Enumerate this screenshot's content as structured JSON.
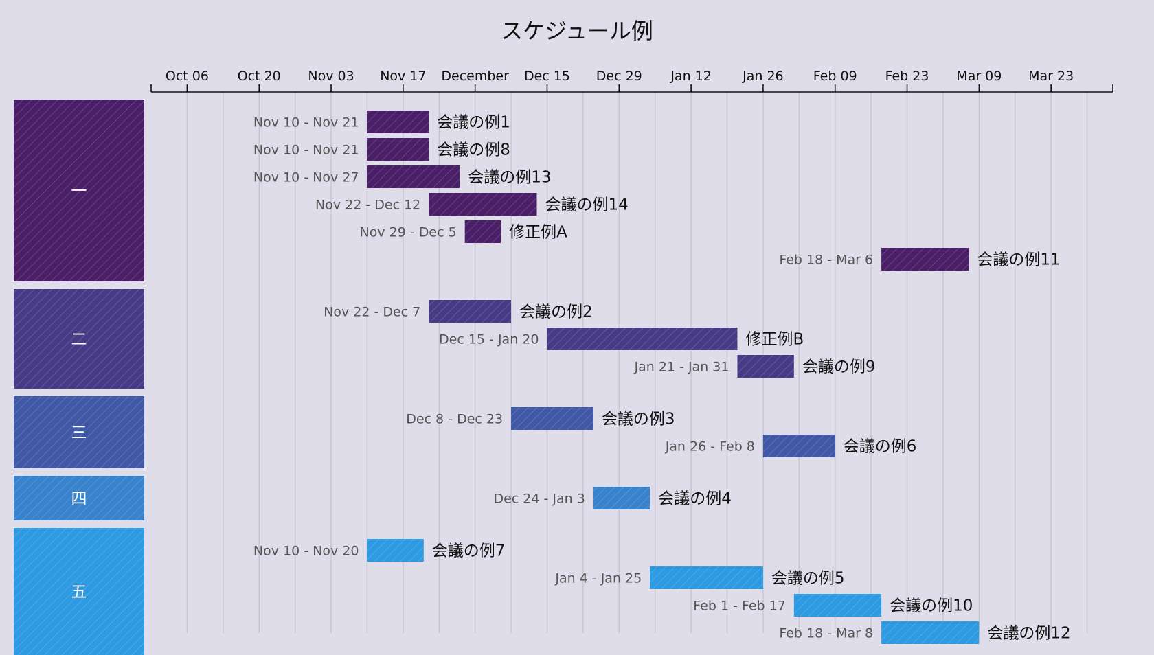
{
  "chart_data": {
    "type": "gantt",
    "title": "スケジュール例",
    "x_start": "2024-09-29",
    "x_end": "2025-04-04",
    "ticks": [
      {
        "date": "2024-10-06",
        "label": "Oct 06"
      },
      {
        "date": "2024-10-20",
        "label": "Oct 20"
      },
      {
        "date": "2024-11-03",
        "label": "Nov 03"
      },
      {
        "date": "2024-11-17",
        "label": "Nov 17"
      },
      {
        "date": "2024-12-01",
        "label": "December"
      },
      {
        "date": "2024-12-15",
        "label": "Dec 15"
      },
      {
        "date": "2024-12-29",
        "label": "Dec 29"
      },
      {
        "date": "2025-01-12",
        "label": "Jan 12"
      },
      {
        "date": "2025-01-26",
        "label": "Jan 26"
      },
      {
        "date": "2025-02-09",
        "label": "Feb 09"
      },
      {
        "date": "2025-02-23",
        "label": "Feb 23"
      },
      {
        "date": "2025-03-09",
        "label": "Mar 09"
      },
      {
        "date": "2025-03-23",
        "label": "Mar 23"
      }
    ],
    "groups": [
      {
        "name": "一",
        "color": "#4a1f68",
        "tasks": [
          {
            "name": "会議の例1",
            "start": "2024-11-10",
            "end": "2024-11-21",
            "range_label": "Nov 10 - Nov 21"
          },
          {
            "name": "会議の例8",
            "start": "2024-11-10",
            "end": "2024-11-21",
            "range_label": "Nov 10 - Nov 21"
          },
          {
            "name": "会議の例13",
            "start": "2024-11-10",
            "end": "2024-11-27",
            "range_label": "Nov 10 - Nov 27"
          },
          {
            "name": "会議の例14",
            "start": "2024-11-22",
            "end": "2024-12-12",
            "range_label": "Nov 22 - Dec 12"
          },
          {
            "name": "修正例A",
            "start": "2024-11-29",
            "end": "2024-12-05",
            "range_label": "Nov 29 - Dec 5"
          },
          {
            "name": "会議の例11",
            "start": "2025-02-18",
            "end": "2025-03-06",
            "range_label": "Feb 18 - Mar 6"
          }
        ]
      },
      {
        "name": "二",
        "color": "#473b86",
        "tasks": [
          {
            "name": "会議の例2",
            "start": "2024-11-22",
            "end": "2024-12-07",
            "range_label": "Nov 22 - Dec 7"
          },
          {
            "name": "修正例B",
            "start": "2024-12-15",
            "end": "2025-01-20",
            "range_label": "Dec 15 - Jan 20"
          },
          {
            "name": "会議の例9",
            "start": "2025-01-21",
            "end": "2025-01-31",
            "range_label": "Jan 21 - Jan 31"
          }
        ]
      },
      {
        "name": "三",
        "color": "#4058a6",
        "tasks": [
          {
            "name": "会議の例3",
            "start": "2024-12-08",
            "end": "2024-12-23",
            "range_label": "Dec 8 - Dec 23"
          },
          {
            "name": "会議の例6",
            "start": "2025-01-26",
            "end": "2025-02-08",
            "range_label": "Jan 26 - Feb 8"
          }
        ]
      },
      {
        "name": "四",
        "color": "#3982cc",
        "tasks": [
          {
            "name": "会議の例4",
            "start": "2024-12-24",
            "end": "2025-01-03",
            "range_label": "Dec 24 - Jan 3"
          }
        ]
      },
      {
        "name": "五",
        "color": "#2e9ae2",
        "tasks": [
          {
            "name": "会議の例7",
            "start": "2024-11-10",
            "end": "2024-11-20",
            "range_label": "Nov 10 - Nov 20"
          },
          {
            "name": "会議の例5",
            "start": "2025-01-04",
            "end": "2025-01-25",
            "range_label": "Jan 4 - Jan 25"
          },
          {
            "name": "会議の例10",
            "start": "2025-02-01",
            "end": "2025-02-17",
            "range_label": "Feb 1 - Feb 17"
          },
          {
            "name": "会議の例12",
            "start": "2025-02-18",
            "end": "2025-03-08",
            "range_label": "Feb 18 - Mar 8"
          }
        ]
      }
    ]
  }
}
